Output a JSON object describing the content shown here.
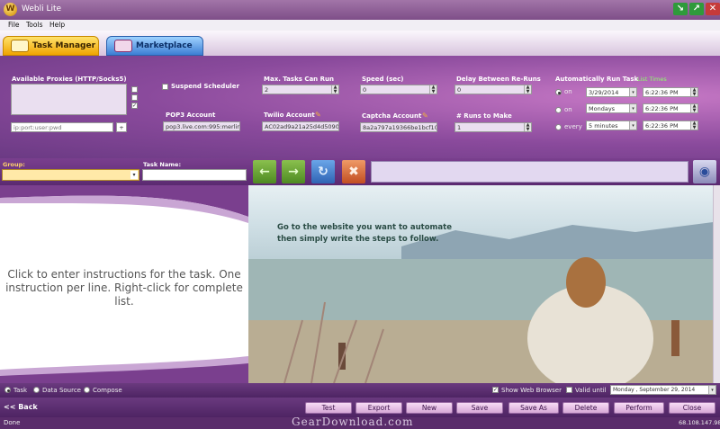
{
  "window": {
    "title": "Webli Lite",
    "icon_letter": "W"
  },
  "menu": [
    "File",
    "Tools",
    "Help"
  ],
  "tabs": {
    "task_manager": "Task Manager",
    "marketplace": "Marketplace"
  },
  "config": {
    "proxies_label": "Available Proxies (HTTP/Socks5)",
    "proxy_input_placeholder": "ip:port:user:pwd",
    "proxy_add": "+",
    "suspend_label": "Suspend Scheduler",
    "pop3_label": "POP3 Account",
    "pop3_value": "pop3.live.com:995:merlin",
    "max_tasks_label": "Max. Tasks Can Run",
    "max_tasks_value": "2",
    "twilio_label": "Twilio Account",
    "twilio_value": "AC02ad9a21a25d4d5090e",
    "speed_label": "Speed (sec)",
    "speed_value": "0",
    "captcha_label": "Captcha Account",
    "captcha_value": "8a2a797a19366be1bcf10f",
    "delay_label": "Delay Between Re-Runs",
    "delay_value": "0",
    "runs_label": "# Runs to Make",
    "runs_value": "1",
    "auto_label": "Automatically Run Task",
    "list_times": "List Times",
    "radio_on1": "on",
    "radio_on2": "on",
    "radio_every": "every",
    "date_value": "3/29/2014",
    "day_value": "Mondays",
    "interval_value": "5 minutes",
    "time1": "6:22:36 PM",
    "time2": "6:22:36 PM",
    "time3": "6:22:36 PM"
  },
  "groupbar": {
    "group_label": "Group:",
    "task_label": "Task Name:"
  },
  "instructions_hint": "Click to enter instructions for the task. One instruction per line. Right-click for complete list.",
  "photo_text": "Go to the website you want to automate then simply write the steps to follow.",
  "options": {
    "radio_task": "Task",
    "radio_datasource": "Data Source",
    "radio_compose": "Compose",
    "show_browser": "Show Web Browser",
    "valid_until": "Valid until",
    "valid_date": "Monday , September 29, 2014"
  },
  "buttons": {
    "back": "<< Back",
    "test": "Test",
    "export": "Export",
    "new": "New",
    "save": "Save",
    "save_as": "Save As",
    "delete": "Delete",
    "perform": "Perform",
    "close": "Close"
  },
  "status": {
    "left": "Done",
    "ip": "68.108.147.98",
    "watermark": "GearDownload.com"
  },
  "colors": {
    "accent_yellow": "#f0a400",
    "accent_blue": "#3c7ed4",
    "purple_dark": "#5b2c69"
  }
}
